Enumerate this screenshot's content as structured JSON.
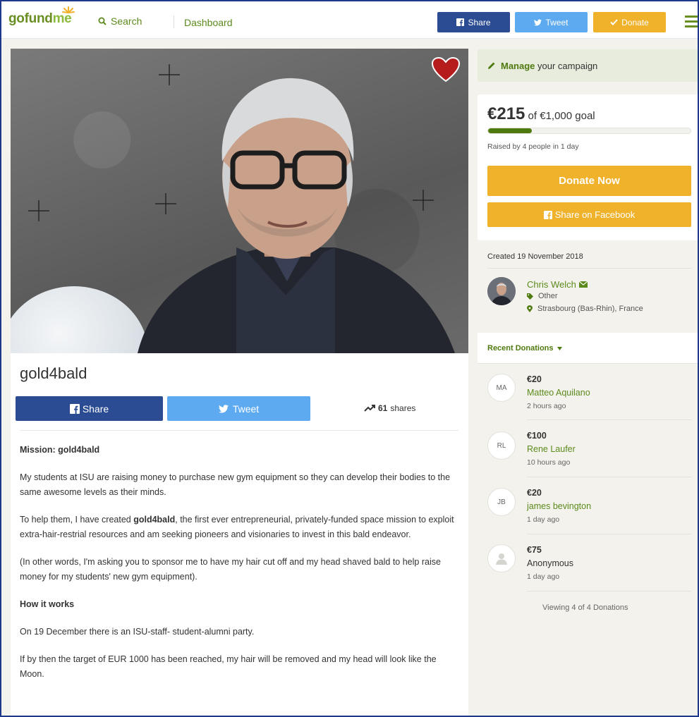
{
  "header": {
    "logo": {
      "go": "go",
      "fund": "fund",
      "me": "me"
    },
    "search_label": "Search",
    "dashboard_label": "Dashboard",
    "share_label": "Share",
    "tweet_label": "Tweet",
    "donate_label": "Donate"
  },
  "campaign": {
    "title": "gold4bald",
    "share_label": "Share",
    "tweet_label": "Tweet",
    "shares_count": "61",
    "shares_suffix": "shares"
  },
  "story": {
    "heading1": "Mission: gold4bald",
    "p1": "My students at ISU are raising money to purchase new gym equipment so they can develop their bodies to the same awesome levels as their minds.",
    "p2_before": "To help them, I have created ",
    "p2_bold": "gold4bald",
    "p2_after": ", the first ever entrepreneurial, privately-funded space mission to exploit extra-hair-restrial resources and am seeking pioneers and visionaries to invest in this bald endeavor.",
    "p3": "(In other words, I'm asking you to sponsor me to have my hair cut off and my head shaved bald to help raise money for my students' new gym equipment).",
    "heading2": "How it works",
    "p4": "On 19 December there is an ISU-staff- student-alumni party.",
    "p5": "If by then the target of EUR 1000 has been reached, my hair will be removed and my head will look like the Moon."
  },
  "sidebar": {
    "manage_bold": "Manage",
    "manage_rest": " your campaign",
    "raised_amount": "€215",
    "raised_goal": " of €1,000 goal",
    "progress": 0.215,
    "raised_meta": "Raised by 4 people in 1 day",
    "donate_now_label": "Donate Now",
    "share_facebook_label": "Share on Facebook",
    "created": "Created 19 November 2018",
    "organizer": {
      "name": "Chris Welch",
      "category": "Other",
      "location": "Strasbourg (Bas-Rhin), France"
    },
    "recent_donations_label": "Recent Donations",
    "donations": [
      {
        "initials": "MA",
        "amount": "€20",
        "name": "Matteo Aquilano",
        "time": "2 hours ago"
      },
      {
        "initials": "RL",
        "amount": "€100",
        "name": "Rene Laufer",
        "time": "10 hours ago"
      },
      {
        "initials": "JB",
        "amount": "€20",
        "name": "james bevington",
        "time": "1 day ago"
      },
      {
        "initials": "",
        "amount": "€75",
        "name": "Anonymous",
        "time": "1 day ago"
      }
    ],
    "viewing": "Viewing 4 of 4 Donations"
  },
  "colors": {
    "brand_green": "#4f7a0f",
    "facebook_blue": "#2b4b93",
    "twitter_blue": "#5daaf0",
    "donate_orange": "#f0b12b"
  }
}
